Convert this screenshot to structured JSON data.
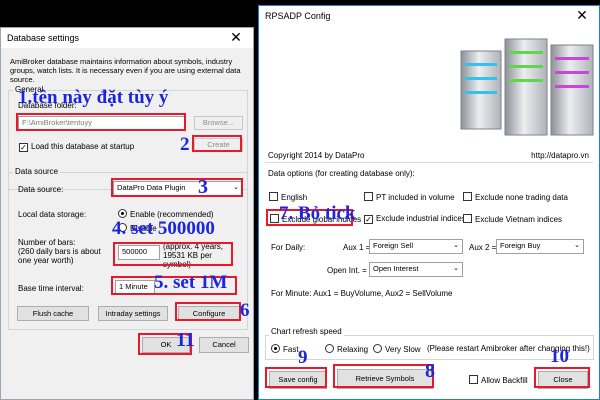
{
  "db": {
    "title": "Database settings",
    "close_glyph": "✕",
    "intro": "AmiBroker database maintains information about symbols, industry groups, watch lists. It is necessary even if you are using external data source.",
    "general_label": "General",
    "folder_label": "Database folder:",
    "folder_value": "F:\\AmiBroker\\tentuyy",
    "browse_label": "Browse...",
    "create_label": "Create",
    "load_label": "Load this database at startup",
    "data_source_group": "Data source",
    "data_source_label": "Data source:",
    "data_source_value": "DataPro Data Plugin",
    "local_storage_label": "Local data storage:",
    "enable_label": "Enable (recommended)",
    "disable_label": "Disable",
    "bars_label": "Number of bars:",
    "bars_note": "(260 daily bars is about one year worth)",
    "bars_value": "500000",
    "bars_approx": "(approx. 4 years, 19531 KB per symbol)",
    "interval_label": "Base time interval:",
    "interval_value": "1 Minute",
    "flush_label": "Flush cache",
    "intraday_label": "Intraday settings",
    "configure_label": "Configure",
    "ok_label": "OK",
    "cancel_label": "Cancel"
  },
  "rp": {
    "title": "RPSADP Config",
    "close_glyph": "✕",
    "copyright": "Copyright 2014 by DataPro",
    "url": "http://datapro.vn",
    "options_label": "Data options (for creating database only):",
    "english_label": "English",
    "pt_label": "PT included in volume",
    "exclude_none_label": "Exclude none trading data",
    "exclude_global_label": "Exclude global indices",
    "exclude_industrial_label": "Exclude industrial indices",
    "exclude_vietnam_label": "Exclude Vietnam indices",
    "for_daily_label": "For Daily:",
    "aux1_label": "Aux 1 =",
    "aux1_value": "Foreign Sell",
    "aux2_label": "Aux 2 =",
    "aux2_value": "Foreign Buy",
    "open_int_label": "Open Int. =",
    "open_int_value": "Open Interest",
    "for_minute_text": "For Minute: Aux1 = BuyVolume, Aux2 = SellVolume",
    "refresh_group": "Chart refresh speed",
    "fast_label": "Fast",
    "relaxing_label": "Relaxing",
    "very_slow_label": "Very Slow",
    "restart_note": "(Please restart Amibroker after changing this!)",
    "save_label": "Save config",
    "retrieve_label": "Retrieve Symbols",
    "allow_backfill_label": "Allow Backfill",
    "close_label": "Close"
  },
  "annotations": {
    "a1": "1.tên này đặt tùy ý",
    "a2": "2",
    "a3": "3",
    "a4": "4. set 500000",
    "a5": "5. set 1M",
    "a6": "6",
    "a7": "7. Bỏ tick",
    "a8": "8",
    "a9": "9",
    "a10": "10",
    "a11": "11"
  },
  "colors": {
    "annotation_text": "#1b24e0",
    "annotation_box": "#e8192c",
    "title_accent": "#1883d7"
  }
}
